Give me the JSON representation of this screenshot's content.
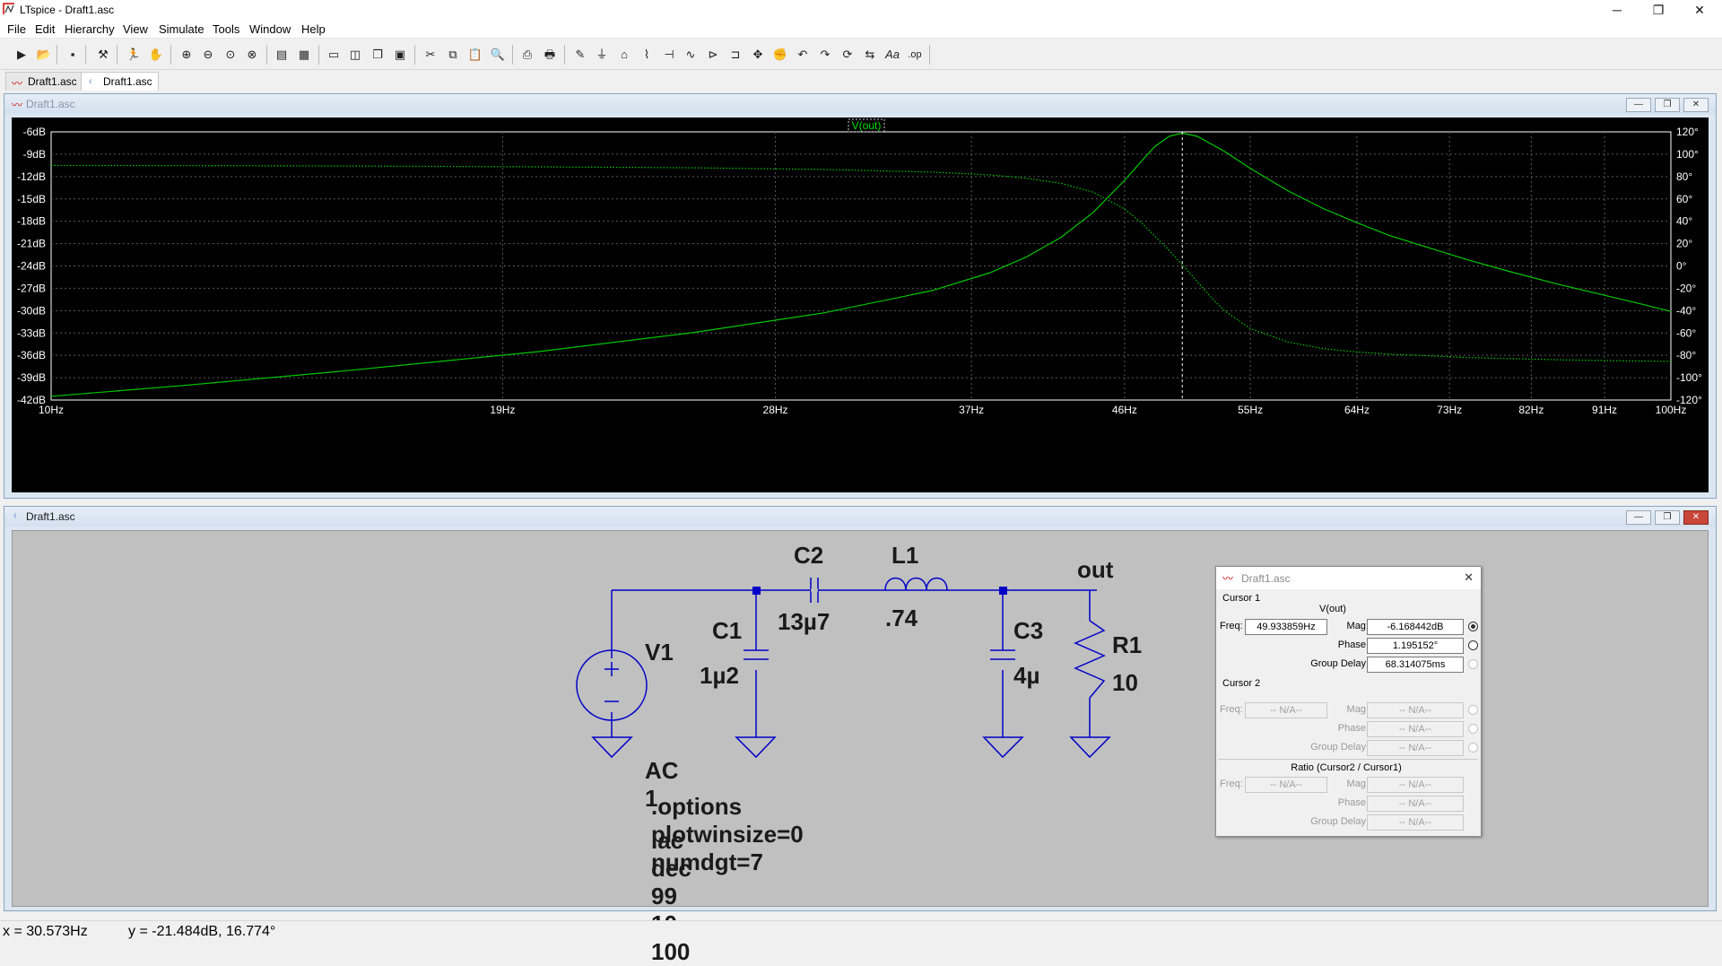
{
  "window": {
    "title": "LTspice - Draft1.asc",
    "controls": {
      "minimize": "─",
      "restore": "❐",
      "close": "✕"
    }
  },
  "menu": [
    "File",
    "Edit",
    "Hierarchy",
    "View",
    "Simulate",
    "Tools",
    "Window",
    "Help"
  ],
  "toolbar": {
    "icons": [
      "new-schematic-icon",
      "open-icon",
      "save-icon",
      "control-panel-icon",
      "run-icon",
      "halt-icon",
      "zoom-in-icon",
      "zoom-out-icon",
      "zoom-full-icon",
      "cancel-zoom-icon",
      "autorange-icon",
      "grid-icon",
      "tile-horizontal-icon",
      "tile-vertical-icon",
      "cascade-icon",
      "close-all-icon",
      "cut-icon",
      "copy-icon",
      "paste-icon",
      "find-icon",
      "print-setup-icon",
      "print-icon",
      "wire-icon",
      "ground-icon",
      "label-icon",
      "resistor-icon",
      "capacitor-icon",
      "inductor-icon",
      "diode-icon",
      "component-icon",
      "move-icon",
      "drag-icon",
      "undo-icon",
      "redo-icon",
      "rotate-icon",
      "mirror-icon",
      "text-icon",
      "spice-directive-icon"
    ]
  },
  "tabs": [
    {
      "label": "Draft1.asc",
      "kind": "waveform"
    },
    {
      "label": "Draft1.asc",
      "kind": "schematic"
    }
  ],
  "plot_window": {
    "title": "Draft1.asc",
    "trace_label": "V(out)"
  },
  "chart_data": {
    "type": "line",
    "title": "",
    "xlabel": "",
    "x_ticks": [
      "10Hz",
      "19Hz",
      "28Hz",
      "37Hz",
      "46Hz",
      "55Hz",
      "64Hz",
      "73Hz",
      "82Hz",
      "91Hz",
      "100Hz"
    ],
    "y_left_ticks": [
      "-6dB",
      "-9dB",
      "-12dB",
      "-15dB",
      "-18dB",
      "-21dB",
      "-24dB",
      "-27dB",
      "-30dB",
      "-33dB",
      "-36dB",
      "-39dB",
      "-42dB"
    ],
    "y_right_ticks": [
      "120°",
      "100°",
      "80°",
      "60°",
      "40°",
      "20°",
      "0°",
      "-20°",
      "-40°",
      "-60°",
      "-80°",
      "-100°",
      "-120°"
    ],
    "xlim": [
      10,
      100
    ],
    "ylim_left": [
      -42,
      -6
    ],
    "ylim_right": [
      -120,
      120
    ],
    "x_scale": "log",
    "grid": true,
    "cursor_x": 49.93,
    "series": [
      {
        "name": "V(out)",
        "axis": "magnitude_dB",
        "style": "solid",
        "x": [
          10,
          12,
          15,
          20,
          25,
          30,
          35,
          38,
          40,
          42,
          44,
          46,
          47,
          48,
          49,
          49.93,
          51,
          53,
          55,
          58,
          61,
          64,
          67,
          70,
          75,
          80,
          85,
          90,
          95,
          100
        ],
        "y": [
          -41.5,
          -40.1,
          -38.2,
          -35.5,
          -32.9,
          -30.3,
          -27.3,
          -24.9,
          -22.8,
          -20.2,
          -16.8,
          -12.5,
          -10.2,
          -8.0,
          -6.6,
          -6.17,
          -6.6,
          -8.6,
          -10.9,
          -13.9,
          -16.3,
          -18.2,
          -19.9,
          -21.2,
          -23.2,
          -24.9,
          -26.4,
          -27.7,
          -28.9,
          -30.1
        ]
      },
      {
        "name": "V(out)",
        "axis": "phase_deg",
        "style": "dotted",
        "x": [
          10,
          15,
          20,
          25,
          30,
          35,
          38,
          40,
          42,
          44,
          46,
          47,
          48,
          49,
          49.93,
          51,
          52,
          53,
          55,
          58,
          61,
          64,
          67,
          70,
          75,
          80,
          85,
          90,
          95,
          100
        ],
        "y": [
          90,
          89.5,
          88.7,
          87.8,
          86.4,
          84,
          81.5,
          78.5,
          74,
          66,
          51,
          40,
          27,
          14,
          1.2,
          -14,
          -28,
          -40,
          -56,
          -68,
          -74,
          -77,
          -79,
          -80,
          -82,
          -83,
          -84,
          -84.5,
          -85,
          -85.5
        ]
      }
    ],
    "colors": {
      "magnitude": "#00c800",
      "phase": "#00c800",
      "cursor": "#ffffff",
      "background": "#000000",
      "grid": "#5a5a5a"
    }
  },
  "schematic_window": {
    "title": "Draft1.asc",
    "components": {
      "V1": {
        "name": "V1",
        "value": "AC 1"
      },
      "C1": {
        "name": "C1",
        "value": "1µ2"
      },
      "C2": {
        "name": "C2",
        "value": "13µ7"
      },
      "L1": {
        "name": "L1",
        "value": ".74"
      },
      "C3": {
        "name": "C3",
        "value": "4µ"
      },
      "R1": {
        "name": "R1",
        "value": "10"
      }
    },
    "net_label": "out",
    "directives": [
      ".options plotwinsize=0 numdgt=7",
      ".ac dec 99 10 100"
    ],
    "wire_color": "#0000c8",
    "text_color": "#1a1a1a"
  },
  "cursor_dialog": {
    "title": "Draft1.asc",
    "cursor1": {
      "section": "Cursor 1",
      "trace": "V(out)",
      "freq_label": "Freq:",
      "freq": "49.933859Hz",
      "mag_label": "Mag:",
      "mag": "-6.168442dB",
      "phase_label": "Phase:",
      "phase": "1.195152°",
      "gd_label": "Group Delay:",
      "gd": "68.314075ms"
    },
    "cursor2": {
      "section": "Cursor 2",
      "freq_label": "Freq:",
      "freq": "-- N/A--",
      "mag_label": "Mag:",
      "mag": "-- N/A--",
      "phase_label": "Phase:",
      "phase": "-- N/A--",
      "gd_label": "Group Delay:",
      "gd": "-- N/A--"
    },
    "ratio": {
      "section": "Ratio (Cursor2 / Cursor1)",
      "freq_label": "Freq:",
      "freq": "-- N/A--",
      "mag_label": "Mag:",
      "mag": "-- N/A--",
      "phase_label": "Phase:",
      "phase": "-- N/A--",
      "gd_label": "Group Delay:",
      "gd": "-- N/A--"
    }
  },
  "status": {
    "x": "x = 30.573Hz",
    "y": "y = -21.484dB, 16.774°"
  }
}
